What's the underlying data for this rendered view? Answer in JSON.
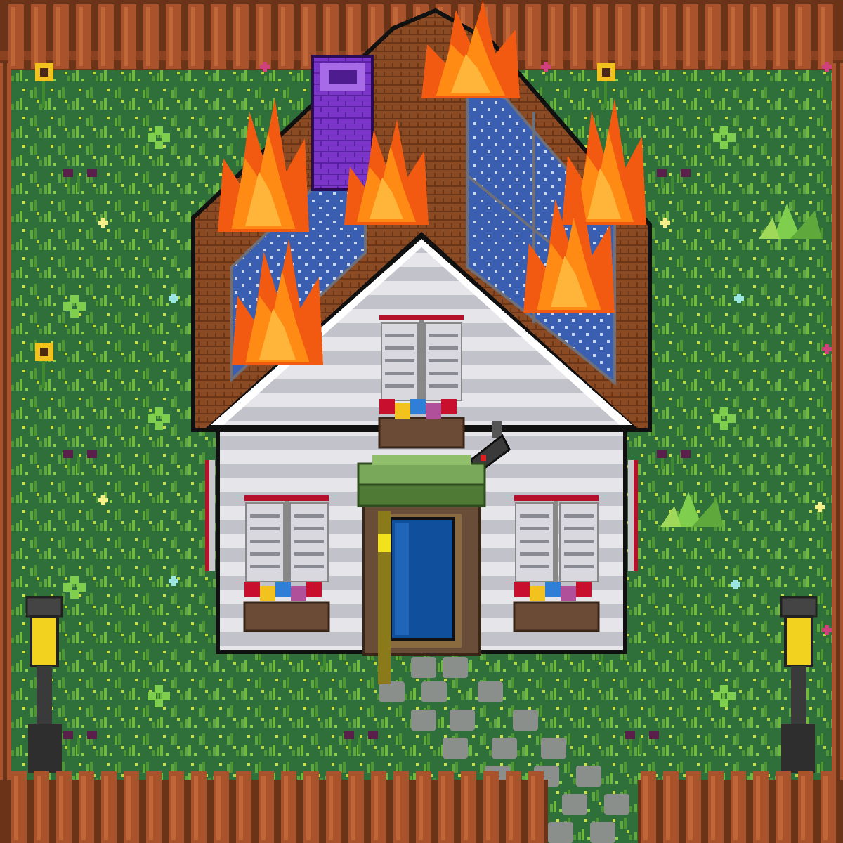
{
  "scene": {
    "type": "pixel-art-game-tile",
    "subject": "burning cottage",
    "elements": [
      "picket-fence",
      "grass-lawn",
      "house",
      "roof",
      "solar-panels",
      "chimney",
      "fire",
      "front-door",
      "awning",
      "window-shutters",
      "flower-planters",
      "security-camera",
      "stone-path",
      "street-lamps",
      "sunflowers",
      "wildflowers"
    ]
  },
  "colors": {
    "grass": "#2f6f3a",
    "grass_blade": "#5fa83c",
    "grass_light": "#8fd04a",
    "fence": "#a8532b",
    "fence_dark": "#6b3318",
    "roof": "#8a4a24",
    "roof_dark": "#4d240f",
    "solar": "#3b5fb0",
    "solar_dot": "#c9d6f2",
    "wall": "#e2e2e6",
    "wall_stripe": "#b9b9c2",
    "trim": "#ffffff",
    "outline": "#111111",
    "chimney": "#7b35c8",
    "chimney_dark": "#4e1c8e",
    "fire_outer": "#f25a12",
    "fire_mid": "#ff8a14",
    "fire_core": "#ffb43a",
    "door": "#0f4f9c",
    "door_frame": "#6a4d38",
    "awning": "#6b9b4a",
    "path_stone": "#8a8f8c",
    "lamp_light": "#f2d21e",
    "lamp_post": "#3a3a3a"
  }
}
